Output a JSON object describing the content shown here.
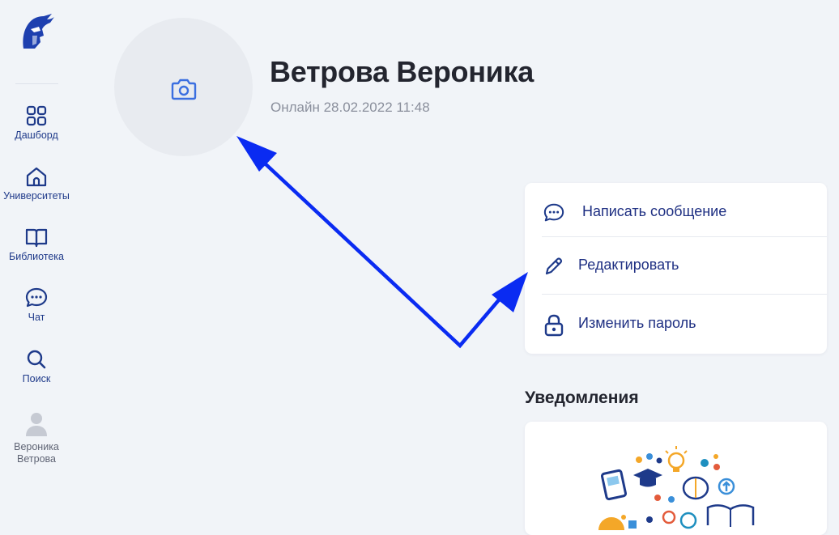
{
  "sidebar": {
    "logo_icon": "knight-helmet-logo",
    "items": [
      {
        "label": "Дашборд",
        "icon": "grid-icon"
      },
      {
        "label": "Университеты",
        "icon": "university-icon"
      },
      {
        "label": "Библиотека",
        "icon": "book-icon"
      },
      {
        "label": "Чат",
        "icon": "chat-icon"
      },
      {
        "label": "Поиск",
        "icon": "search-icon"
      }
    ],
    "user": {
      "label": "Вероника Ветрова",
      "icon": "user-avatar-icon"
    }
  },
  "profile": {
    "name": "Ветрова Вероника",
    "status": "Онлайн 28.02.2022 11:48",
    "avatar_icon": "camera-icon"
  },
  "actions": [
    {
      "label": "Написать сообщение",
      "icon": "chat-icon"
    },
    {
      "label": "Редактировать",
      "icon": "pencil-icon"
    },
    {
      "label": "Изменить пароль",
      "icon": "lock-icon"
    }
  ],
  "notifications": {
    "title": "Уведомления",
    "illustration": "education-illustration"
  },
  "colors": {
    "accent": "#1e2f82",
    "camera": "#3b6fe0",
    "background": "#f1f4f8",
    "annotation_arrow": "#0a2bf2"
  }
}
